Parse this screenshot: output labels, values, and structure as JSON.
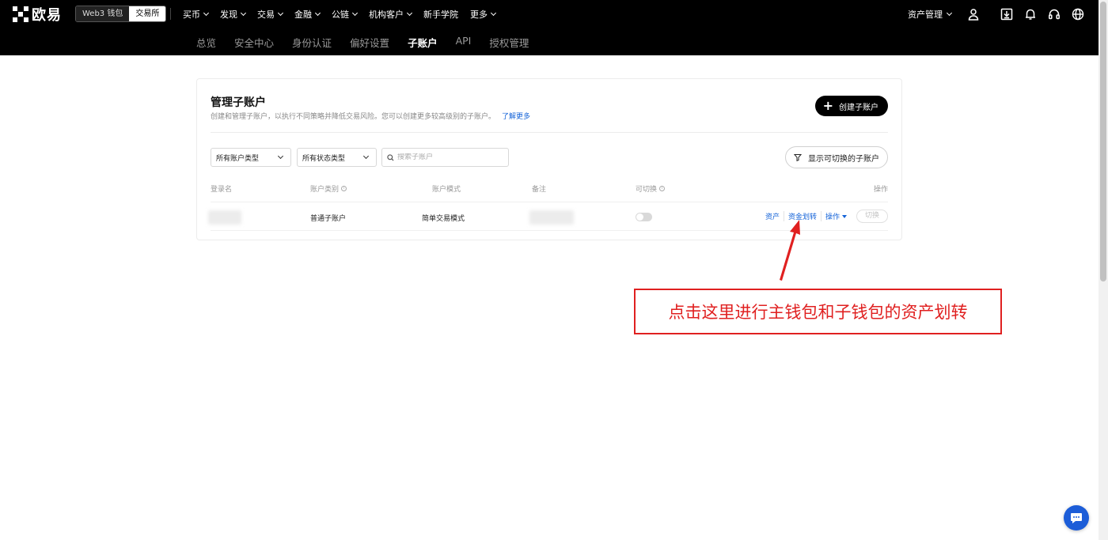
{
  "header": {
    "logo_text": "欧易",
    "mode_web3": "Web3 钱包",
    "mode_exchange": "交易所",
    "nav": [
      {
        "label": "买币",
        "dropdown": true
      },
      {
        "label": "发现",
        "dropdown": true
      },
      {
        "label": "交易",
        "dropdown": true
      },
      {
        "label": "金融",
        "dropdown": true
      },
      {
        "label": "公链",
        "dropdown": true
      },
      {
        "label": "机构客户",
        "dropdown": true
      },
      {
        "label": "新手学院",
        "dropdown": false
      },
      {
        "label": "更多",
        "dropdown": true
      }
    ],
    "asset_management": "资产管理",
    "icons": [
      "user-icon",
      "download-icon",
      "bell-icon",
      "headset-icon",
      "globe-icon"
    ]
  },
  "subnav": {
    "items": [
      "总览",
      "安全中心",
      "身份认证",
      "偏好设置",
      "子账户",
      "API",
      "授权管理"
    ],
    "active_index": 4
  },
  "card": {
    "title": "管理子账户",
    "description": "创建和管理子账户，以执行不同策略并降低交易风险。您可以创建更多较高级别的子账户。",
    "learn_more": "了解更多",
    "create_button": "创建子账户"
  },
  "filters": {
    "account_type": "所有账户类型",
    "status_type": "所有状态类型",
    "search_placeholder": "搜索子账户",
    "show_switchable": "显示可切换的子账户"
  },
  "table": {
    "headers": {
      "login": "登录名",
      "category": "账户类别",
      "mode": "账户模式",
      "note": "备注",
      "switchable": "可切换",
      "actions": "操作"
    },
    "rows": [
      {
        "login": "",
        "category": "普通子账户",
        "mode": "简单交易模式",
        "note": "",
        "switchable": false,
        "actions": {
          "assets": "资产",
          "transfer": "资金划转",
          "operate": "操作",
          "switch": "切换"
        }
      }
    ]
  },
  "annotation": {
    "text": "点击这里进行主钱包和子钱包的资产划转",
    "color": "#e02020"
  },
  "colors": {
    "header_bg": "#000000",
    "link_blue": "#1463d8",
    "chat_blue": "#1c5dd8"
  }
}
